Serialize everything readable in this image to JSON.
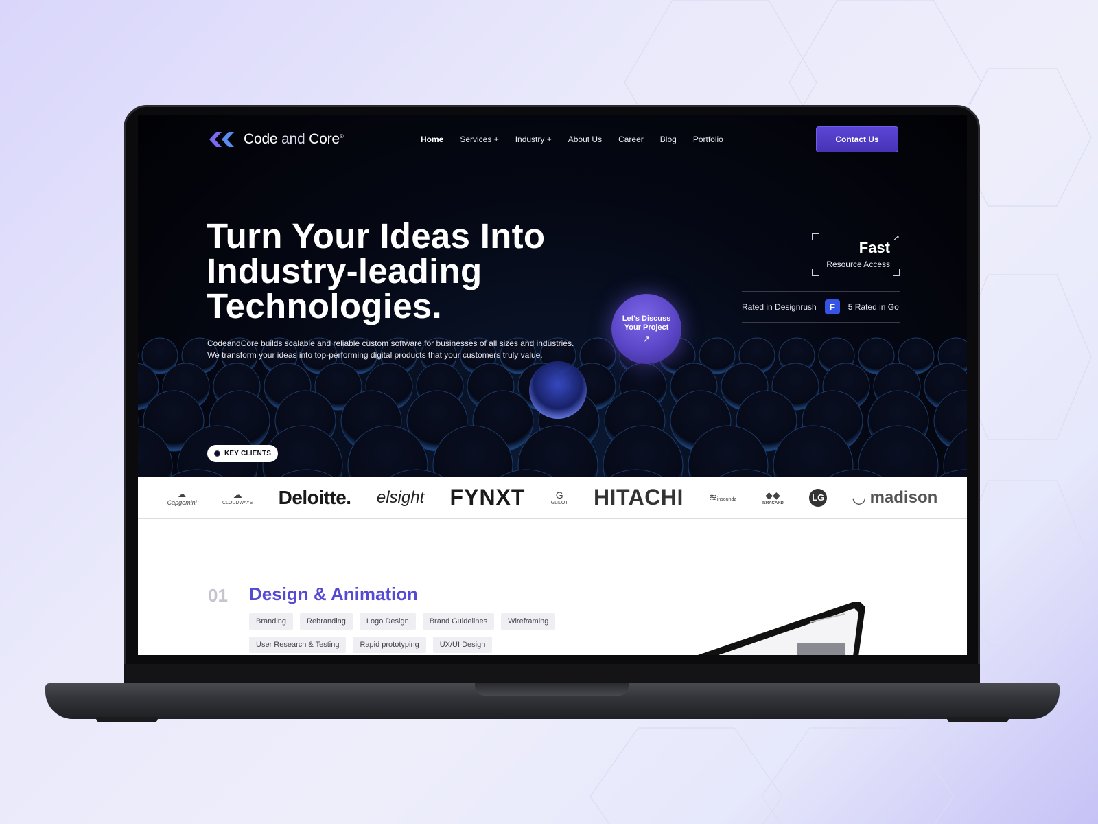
{
  "brand": {
    "name_bold": "Code",
    "name_light": " and ",
    "name_end": "Core",
    "registered": "®"
  },
  "nav": {
    "items": [
      "Home",
      "Services +",
      "Industry +",
      "About Us",
      "Career",
      "Blog",
      "Portfolio"
    ],
    "contact_label": "Contact Us"
  },
  "hero": {
    "headline_line1": "Turn Your Ideas Into",
    "headline_line2": "Industry-leading",
    "headline_line3": "Technologies.",
    "sub_line1": "CodeandCore builds scalable and reliable custom software for businesses of all sizes and industries.",
    "sub_line2": "We transform your ideas into top-performing digital products that your customers truly value.",
    "discuss_line1": "Let's Discuss",
    "discuss_line2": "Your Project",
    "discuss_arrow": "↗",
    "fast_title": "Fast",
    "fast_sub": "Resource Access",
    "rated_1": "Rated in Designrush",
    "rated_2": "5 Rated in Go",
    "key_clients_label": "KEY CLIENTS"
  },
  "clients": [
    "Capgemini",
    "CLOUDWAYS",
    "Deloitte.",
    "elsight",
    "FYNXT",
    "GLILOT",
    "HITACHI",
    "insoundz",
    "ISRACARD",
    "LG",
    "madison"
  ],
  "services": {
    "number": "01",
    "title": "Design & Animation",
    "tags": [
      "Branding",
      "Rebranding",
      "Logo Design",
      "Brand Guidelines",
      "Wireframing",
      "User Research & Testing",
      "Rapid prototyping",
      "UX/UI Design"
    ]
  },
  "colors": {
    "accent": "#5649d4",
    "button": "#4f3bc8",
    "hero_bg": "#030307"
  }
}
